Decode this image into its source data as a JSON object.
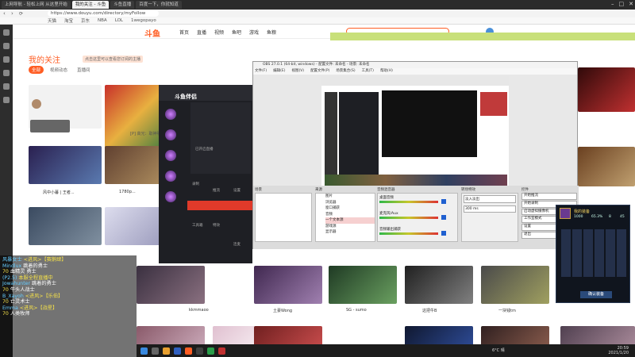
{
  "browser": {
    "tabs": [
      "上网导航 - 轻松上网 从这里开始",
      "我的关注 - 斗鱼",
      "斗鱼直播",
      "百度一下，你就知道"
    ],
    "url": "https://www.douyu.com/directory/myFollow",
    "bookmarks": [
      "天猫",
      "淘宝",
      "京东",
      "NBA",
      "LOL",
      "1wegopayo"
    ]
  },
  "site": {
    "logo": "斗鱼",
    "nav": [
      "首页",
      "直播",
      "视频",
      "鱼吧",
      "游戏",
      "鱼粮"
    ],
    "follow_title": "我的关注",
    "follow_hint": "点击这里可以查看您订阅的主播",
    "tabs": [
      "全部",
      "视频动态",
      "直播间"
    ],
    "cards": [
      {
        "title": "风中小暮 | 王者..."
      },
      {
        "title": "[P] 高光：取神明吧"
      },
      {
        "title": "1780p..."
      },
      {
        "title": "kkmmaoo"
      },
      {
        "title": "土豪Wong"
      },
      {
        "title": "SG - sumo"
      },
      {
        "title": "这把牛B"
      },
      {
        "title": "一块钱tm"
      }
    ]
  },
  "companion": {
    "logo": "斗鱼伴侣",
    "menu_tip": "已开启直播",
    "items": [
      "录制",
      "推流",
      "设置",
      "工具箱",
      "特效",
      "连麦"
    ]
  },
  "obs": {
    "title": "OBS 27.0.1 (64-bit, windows) - 配置文件: 未命名 - 场景: 未命名",
    "menu": [
      "文件(F)",
      "编辑(E)",
      "视图(V)",
      "配置文件(P)",
      "场景集合(S)",
      "工具(T)",
      "帮助(H)"
    ],
    "panels": [
      "场景",
      "来源",
      "音频混音器",
      "转场特效",
      "控件"
    ],
    "sources": [
      "图片",
      "浏览器",
      "窗口捕获",
      "音频",
      "一个文本源",
      "游戏源",
      "显示器"
    ],
    "mixer": [
      "桌面音频",
      "麦克风/Aux",
      "音频输出捕获"
    ],
    "transition": "淡入淡出",
    "duration": "300 ms",
    "controls": [
      "开始推流",
      "开始录制",
      "启动虚拟摄像机",
      "工作室模式",
      "设置",
      "退出"
    ]
  },
  "gamepanel": {
    "title": "我的装备",
    "stats": [
      "1000",
      "65.3%",
      "8",
      "45"
    ],
    "button": "确认装备"
  },
  "chat": [
    {
      "name": "风暴女士",
      "text": "<进风>【赛鹅肆】"
    },
    {
      "name": "Mindlux",
      "text": "跳着的勇士"
    },
    {
      "name": "70",
      "text": "血精灵 勇士"
    },
    {
      "name": "(P2.5)",
      "text": "本服全程直播中"
    },
    {
      "name": "Jowahunter",
      "text": "跳着的勇士"
    },
    {
      "name": "70",
      "text": "牛头人战士"
    },
    {
      "name": "B_Xayoh",
      "text": "<进风>【乐伯】"
    },
    {
      "name": "70",
      "text": "亡灵术士"
    },
    {
      "name": "Emma",
      "text": "<进风>【战星】"
    },
    {
      "name": "70",
      "text": "人类牧师"
    }
  ],
  "taskbar": {
    "time": "20:59",
    "date": "2021/1/20",
    "weather": "6°C 晴"
  }
}
